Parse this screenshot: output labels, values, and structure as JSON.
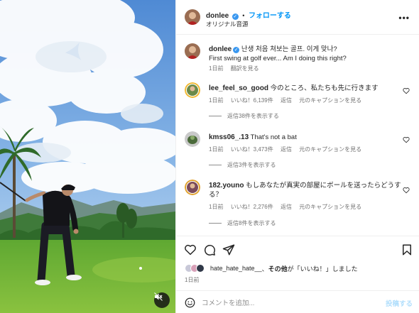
{
  "header": {
    "username": "donlee",
    "separator": "•",
    "follow_label": "フォローする",
    "audio_label": "オリジナル音源",
    "more_label": "•••"
  },
  "caption": {
    "username": "donlee",
    "text_ko": "난생 처음 쳐보는 골프. 이게 맞나?",
    "text_en": "First swing at golf ever... Am I doing this right?",
    "time": "1日前",
    "translate_label": "翻訳を見る"
  },
  "comments": [
    {
      "username": "lee_feel_so_good",
      "text": "今のところ、私たちも先に行きます",
      "time": "1日前",
      "likes": "いいね！6,139件",
      "reply_label": "返信",
      "original_label": "元のキャプションを見る",
      "replies_label": "返信38件を表示する"
    },
    {
      "username": "kmss06_.13",
      "text": "That's not a bat",
      "time": "1日前",
      "likes": "いいね！3,473件",
      "reply_label": "返信",
      "original_label": "元のキャプションを見る",
      "replies_label": "返信3件を表示する"
    },
    {
      "username": "182.youno",
      "text": "もしあなたが真実の部屋にボールを送ったらどうする？",
      "time": "1日前",
      "likes": "いいね！2,276件",
      "reply_label": "返信",
      "original_label": "元のキャプションを見る",
      "replies_label": "返信8件を表示する"
    }
  ],
  "likes_summary": {
    "first_user": "hate_hate_hate__",
    "joiner": "、",
    "others": "その他",
    "suffix": "が「いいね！」しました"
  },
  "post_time": "1日前",
  "comment_box": {
    "placeholder": "コメントを追加...",
    "post_label": "投稿する"
  },
  "colors": {
    "accent": "#0095f6",
    "verified": "#3897f0",
    "muted_text": "#737373",
    "border": "#efefef"
  },
  "icons": [
    "heart-icon",
    "comment-icon",
    "share-icon",
    "bookmark-icon",
    "emoji-icon",
    "mute-icon",
    "more-icon",
    "verified-icon"
  ]
}
